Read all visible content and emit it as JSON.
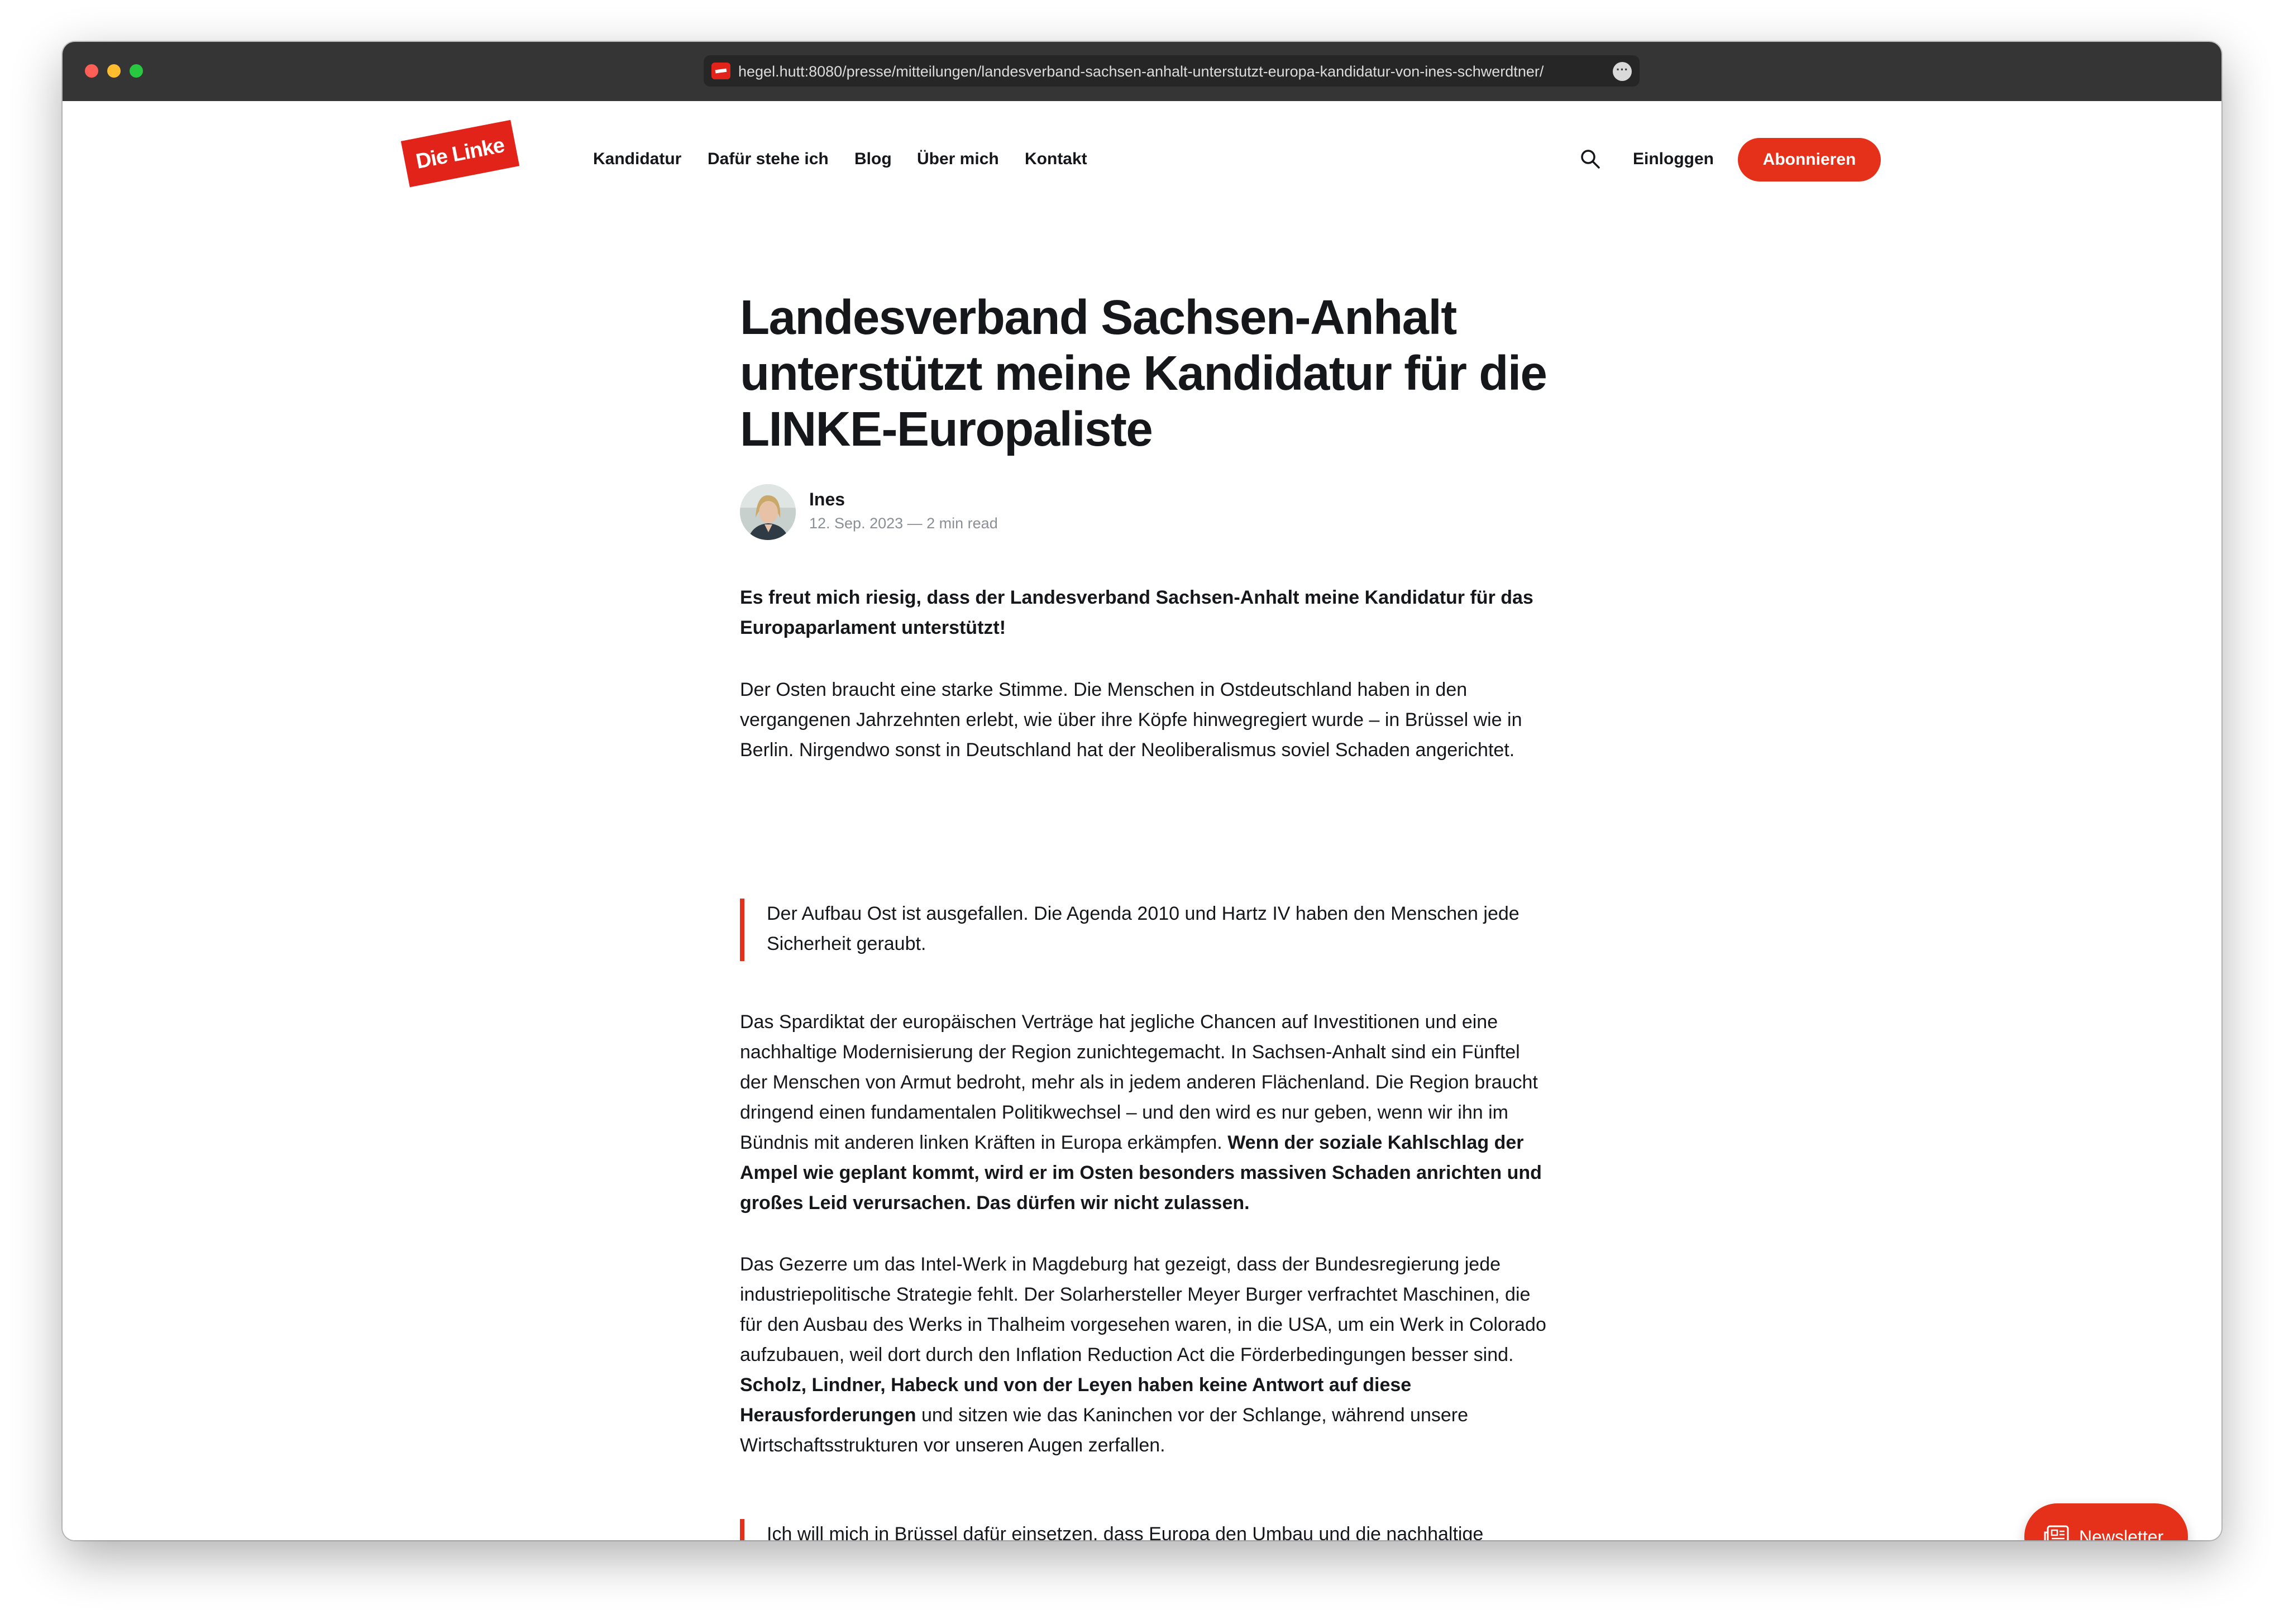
{
  "browser": {
    "url": "hegel.hutt:8080/presse/mitteilungen/landesverband-sachsen-anhalt-unterstutzt-europa-kandidatur-von-ines-schwerdtner/"
  },
  "nav": {
    "logo_text": "Die Linke",
    "items": [
      "Kandidatur",
      "Dafür stehe ich",
      "Blog",
      "Über mich",
      "Kontakt"
    ],
    "login": "Einloggen",
    "subscribe": "Abonnieren"
  },
  "article": {
    "title": "Landesverband Sachsen-Anhalt unterstützt meine Kandidatur für die LINKE-Europaliste",
    "author": "Ines",
    "meta": "12. Sep. 2023 — 2 min read",
    "lead": "Es freut mich riesig, dass der Landesverband Sachsen-Anhalt meine Kandidatur für das Europaparlament unterstützt!",
    "p1": "Der Osten braucht eine starke Stimme. Die Menschen in Ostdeutschland haben in den vergangenen Jahrzehnten erlebt, wie über ihre Köpfe hinwegregiert wurde – in Brüssel wie in Berlin. Nirgendwo sonst in Deutschland hat der Neoliberalismus soviel Schaden angerichtet.",
    "quote1": "Der Aufbau Ost ist ausgefallen. Die Agenda 2010 und Hartz IV haben den Menschen jede Sicherheit geraubt.",
    "p2_normal": "Das Spardiktat der europäischen Verträge hat jegliche Chancen auf Investitionen und eine nachhaltige Modernisierung der Region zunichtegemacht. In Sachsen-Anhalt sind ein Fünftel der Menschen von Armut bedroht, mehr als in jedem anderen Flächenland. Die Region braucht dringend einen fundamentalen Politikwechsel – und den wird es nur geben, wenn wir ihn im Bündnis mit anderen linken Kräften in Europa erkämpfen. ",
    "p2_bold": "Wenn der soziale Kahlschlag der Ampel wie geplant kommt, wird er im Osten besonders massiven Schaden anrichten und großes Leid verursachen. Das dürfen wir nicht zulassen.",
    "p3_normal": "Das Gezerre um das Intel-Werk in Magdeburg hat gezeigt, dass der Bundesregierung jede industriepolitische Strategie fehlt. Der Solarhersteller Meyer Burger verfrachtet Maschinen, die für den Ausbau des Werks in Thalheim vorgesehen waren, in die USA, um ein Werk in Colorado aufzubauen, weil dort durch den Inflation Reduction Act die Förderbedingungen besser sind. ",
    "p3_bold": "Scholz, Lindner, Habeck und von der Leyen haben keine Antwort auf diese Herausforderungen",
    "p3_tail": " und sitzen wie das Kaninchen vor der Schlange, während unsere Wirtschaftsstrukturen vor unseren Augen zerfallen.",
    "quote2": "Ich will mich in Brüssel dafür einsetzen, dass Europa den Umbau und die nachhaltige Modernisierung seiner Industrie entschlossen und selbstbewusst angeht, damit wir nicht"
  },
  "newsletter": {
    "label": "Newsletter"
  },
  "colors": {
    "accent": "#e5311a",
    "text": "#15171a",
    "titlebar": "#353535"
  },
  "icons": [
    "favicon-icon",
    "more-icon",
    "search-icon",
    "newsletter-icon"
  ]
}
